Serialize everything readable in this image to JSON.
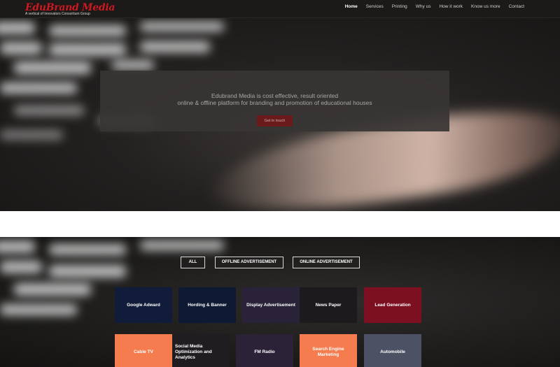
{
  "brand": {
    "name": "EduBrand Media",
    "tagline": "A vertical of Innovators Consortium Group",
    "color": "#c51d25"
  },
  "nav": {
    "items": [
      {
        "label": "Home",
        "active": true
      },
      {
        "label": "Services",
        "active": false
      },
      {
        "label": "Printing",
        "active": false
      },
      {
        "label": "Why us",
        "active": false
      },
      {
        "label": "How it work",
        "active": false
      },
      {
        "label": "Know us more",
        "active": false
      },
      {
        "label": "Contact",
        "active": false
      }
    ]
  },
  "hero": {
    "line1": "Edubrand Media is cost effective, result oriented",
    "line2": "online & offline platform for branding and promotion of educational houses",
    "cta": "Get in touch"
  },
  "filters": [
    {
      "label": "ALL"
    },
    {
      "label": "OFFLINE ADVERTISEMENT"
    },
    {
      "label": "ONLINE ADVERTISEMENT"
    }
  ],
  "tiles_row1": [
    {
      "label": "Google Adward",
      "color": "#101c3a"
    },
    {
      "label": "Hording & Banner",
      "color": "#0e1a34"
    },
    {
      "label": "Display Advertisement",
      "color": "#2a2238"
    },
    {
      "label": "News Paper",
      "color": "#1c1a1d"
    },
    {
      "label": "Lead Generation",
      "color": "#7d1020"
    }
  ],
  "tiles_row2": [
    {
      "label": "Cable TV",
      "color": "#f47c4e"
    },
    {
      "label": "Social Media Optimization and Analytics",
      "color": "#1f1d1f"
    },
    {
      "label": "FM Radio",
      "color": "#2b2238"
    },
    {
      "label": "Search Engine Marketing",
      "color": "#f47c4e"
    },
    {
      "label": "Automobile",
      "color": "#4c5264"
    }
  ]
}
